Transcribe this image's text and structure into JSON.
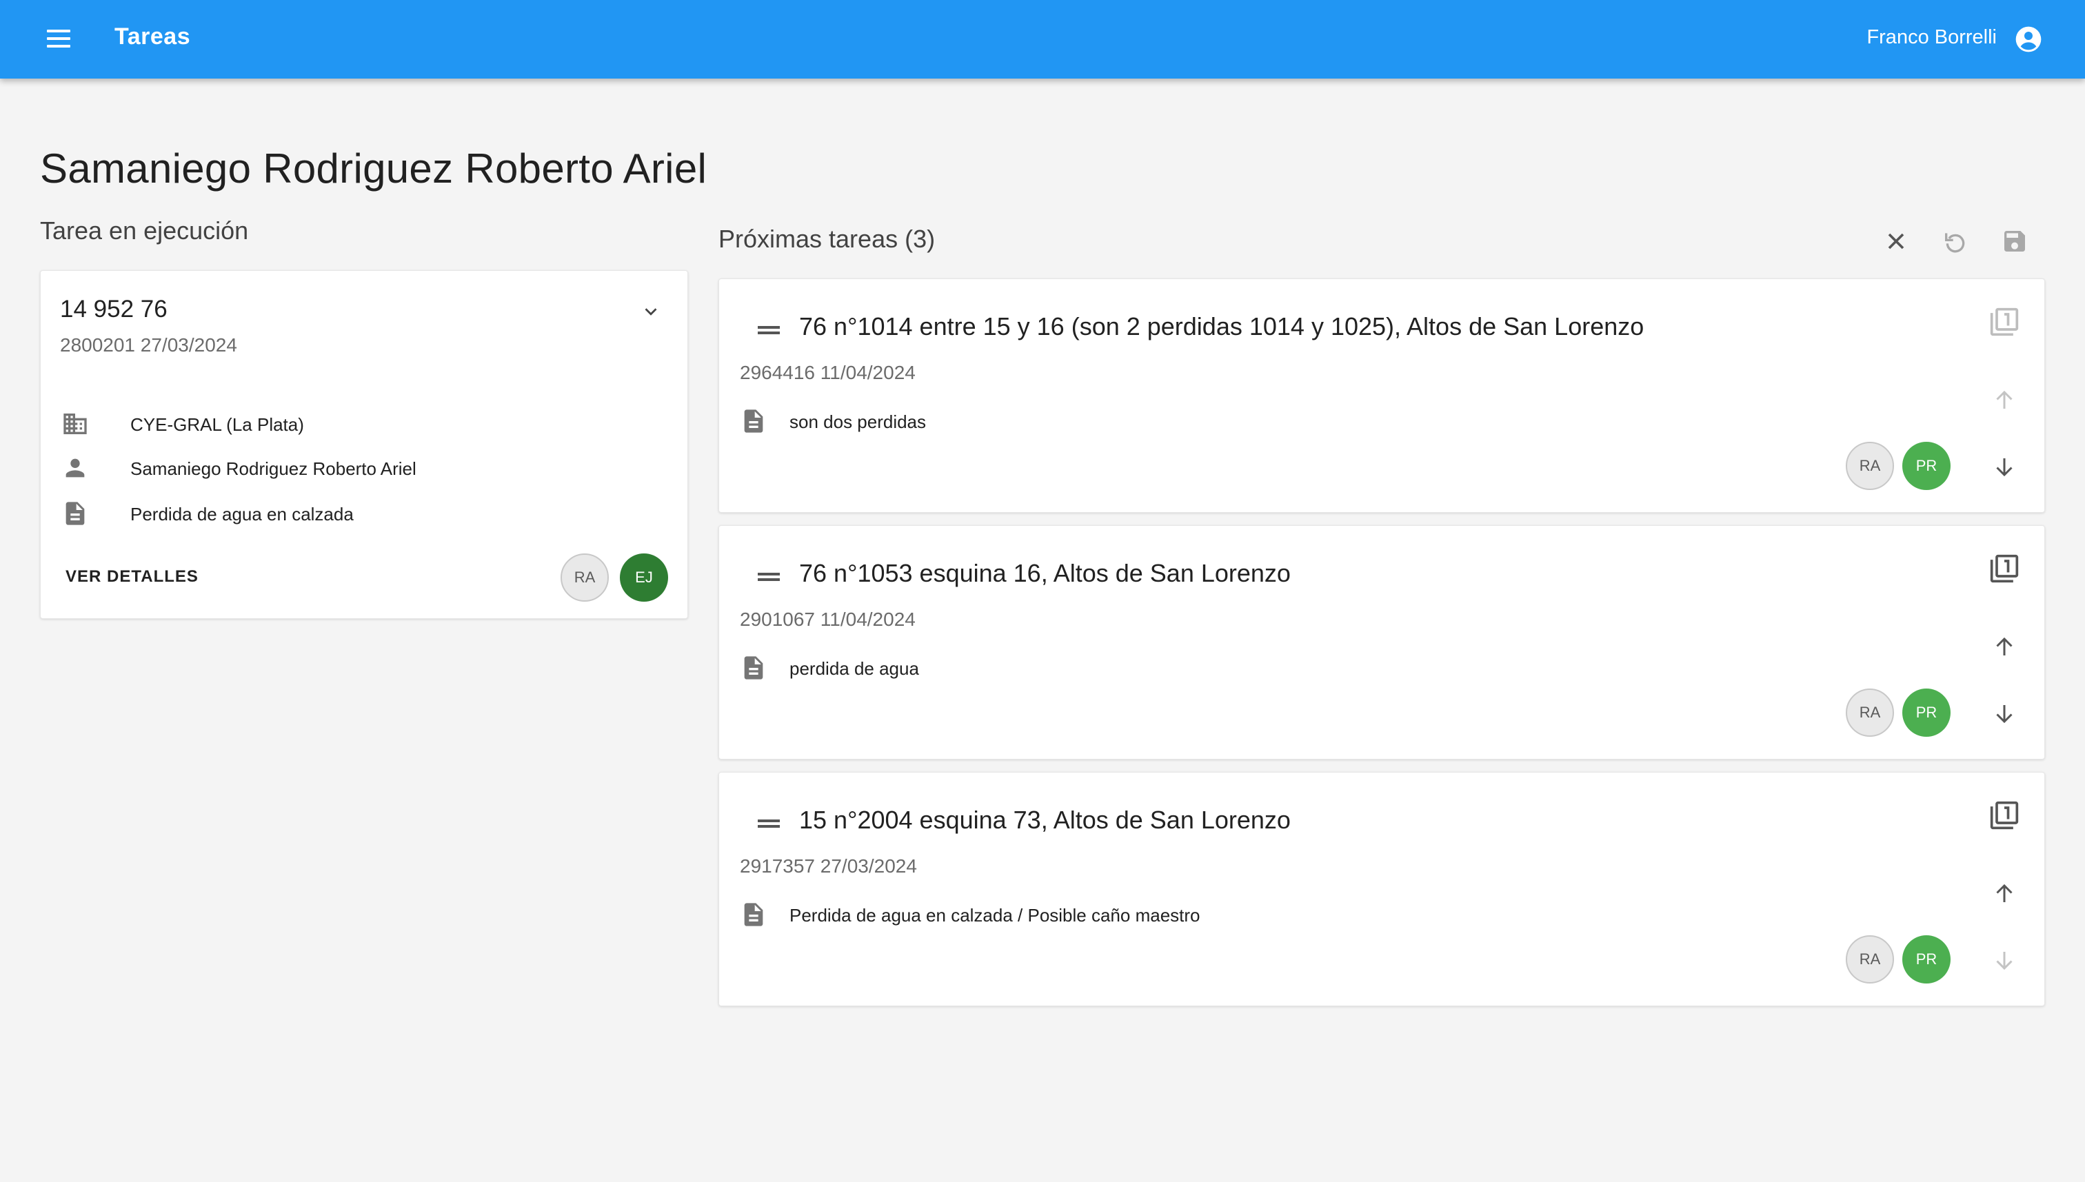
{
  "header": {
    "title": "Tareas",
    "user_name": "Franco Borrelli",
    "icons": {
      "menu": "menu-icon",
      "account": "account-circle-icon"
    },
    "color": "#2196f3"
  },
  "page_title": "Samaniego Rodriguez Roberto Ariel",
  "current_task": {
    "section_title": "Tarea en ejecución",
    "number": "14 952 76",
    "subtitle": "2800201 27/03/2024",
    "location": "CYE-GRAL (La Plata)",
    "person": "Samaniego Rodriguez Roberto Ariel",
    "description": "Perdida de agua en calzada",
    "details_label": "VER DETALLES",
    "badges": [
      {
        "label": "RA",
        "style": "neutral"
      },
      {
        "label": "EJ",
        "style": "dark-green",
        "color": "#2e7d32"
      }
    ]
  },
  "upcoming": {
    "section_title": "Próximas tareas (3)",
    "toolbar_icons": [
      "close-icon",
      "undo-icon",
      "save-icon"
    ],
    "tasks": [
      {
        "title": "76 n°1014 entre 15 y 16 (son 2 perdidas 1014 y 1025), Altos de San Lorenzo",
        "subtitle": "2964416 11/04/2024",
        "description": "son dos perdidas",
        "badges": [
          "RA",
          "PR"
        ],
        "copy_enabled": false,
        "up_enabled": false,
        "down_enabled": true
      },
      {
        "title": "76 n°1053 esquina 16, Altos de San Lorenzo",
        "subtitle": "2901067 11/04/2024",
        "description": "perdida de agua",
        "badges": [
          "RA",
          "PR"
        ],
        "copy_enabled": true,
        "up_enabled": true,
        "down_enabled": true
      },
      {
        "title": "15 n°2004 esquina 73, Altos de San Lorenzo",
        "subtitle": "2917357 27/03/2024",
        "description": "Perdida de agua en calzada / Posible caño maestro",
        "badges": [
          "RA",
          "PR"
        ],
        "copy_enabled": true,
        "up_enabled": true,
        "down_enabled": false
      }
    ],
    "pr_color": "#4caf50"
  }
}
